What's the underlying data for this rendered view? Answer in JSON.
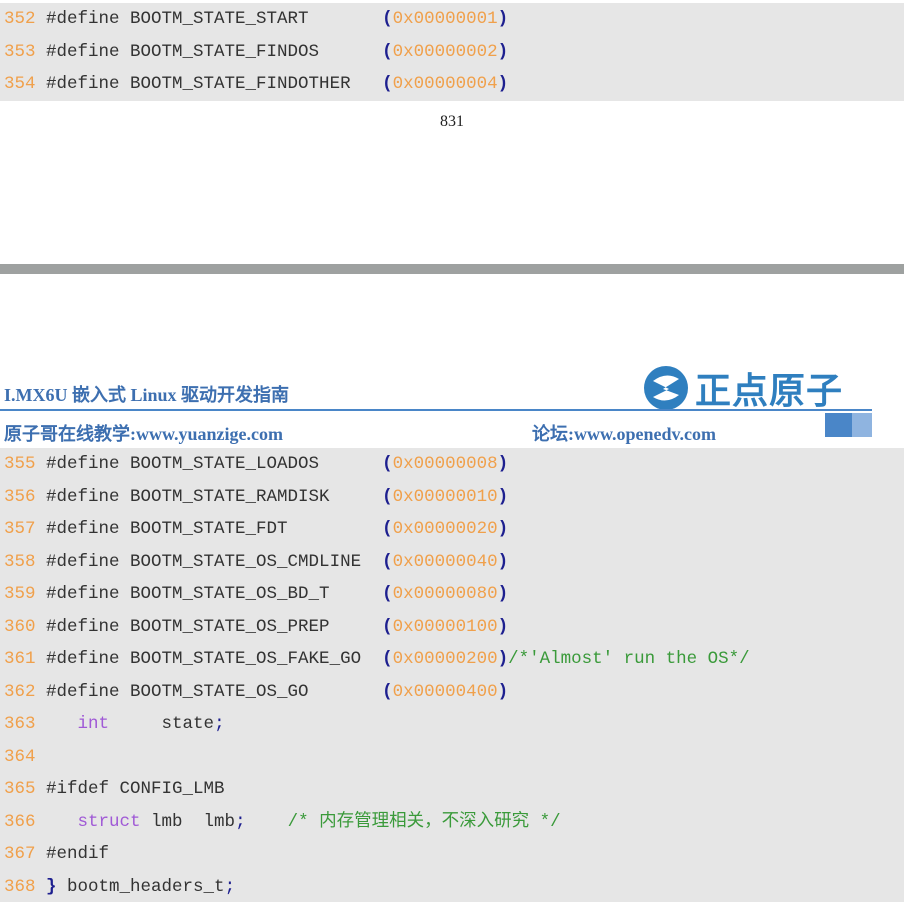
{
  "page_number": "831",
  "header": {
    "title": "I.MX6U 嵌入式 Linux 驱动开发指南",
    "brand": "正点原子",
    "left_link": "原子哥在线教学:www.yuanzige.com",
    "right_link": "论坛:www.openedv.com"
  },
  "colors": {
    "line_number": "#f0a04b",
    "hex_value": "#f0a04b",
    "paren": "#1d1f8f",
    "keyword": "#a05ad6",
    "comment": "#3a9a3a",
    "brand_blue": "#3d6fb0",
    "code_bg": "#e6e6e6"
  },
  "code_top": [
    {
      "ln": "352",
      "text": " #define BOOTM_STATE_START       ",
      "open": "(",
      "hex": "0x00000001",
      "close": ")"
    },
    {
      "ln": "353",
      "text": " #define BOOTM_STATE_FINDOS      ",
      "open": "(",
      "hex": "0x00000002",
      "close": ")"
    },
    {
      "ln": "354",
      "text": " #define BOOTM_STATE_FINDOTHER   ",
      "open": "(",
      "hex": "0x00000004",
      "close": ")"
    }
  ],
  "code_bottom_defines": [
    {
      "ln": "355",
      "text": " #define BOOTM_STATE_LOADOS      ",
      "open": "(",
      "hex": "0x00000008",
      "close": ")",
      "comment": ""
    },
    {
      "ln": "356",
      "text": " #define BOOTM_STATE_RAMDISK     ",
      "open": "(",
      "hex": "0x00000010",
      "close": ")",
      "comment": ""
    },
    {
      "ln": "357",
      "text": " #define BOOTM_STATE_FDT         ",
      "open": "(",
      "hex": "0x00000020",
      "close": ")",
      "comment": ""
    },
    {
      "ln": "358",
      "text": " #define BOOTM_STATE_OS_CMDLINE  ",
      "open": "(",
      "hex": "0x00000040",
      "close": ")",
      "comment": ""
    },
    {
      "ln": "359",
      "text": " #define BOOTM_STATE_OS_BD_T     ",
      "open": "(",
      "hex": "0x00000080",
      "close": ")",
      "comment": ""
    },
    {
      "ln": "360",
      "text": " #define BOOTM_STATE_OS_PREP     ",
      "open": "(",
      "hex": "0x00000100",
      "close": ")",
      "comment": ""
    },
    {
      "ln": "361",
      "text": " #define BOOTM_STATE_OS_FAKE_GO  ",
      "open": "(",
      "hex": "0x00000200",
      "close": ")",
      "comment": "/*'Almost' run the OS*/"
    },
    {
      "ln": "362",
      "text": " #define BOOTM_STATE_OS_GO       ",
      "open": "(",
      "hex": "0x00000400",
      "close": ")",
      "comment": ""
    }
  ],
  "code_bottom_rest": {
    "l363": {
      "ln": "363",
      "indent": "    ",
      "kw": "int",
      "text": "     state",
      "semi": ";"
    },
    "l364": {
      "ln": "364"
    },
    "l365": {
      "ln": "365",
      "text": " #ifdef CONFIG_LMB"
    },
    "l366": {
      "ln": "366",
      "indent": "    ",
      "kw": "struct",
      "text": " lmb  lmb",
      "semi": ";",
      "comment": "    /* 内存管理相关，不深入研究 */"
    },
    "l367": {
      "ln": "367",
      "text": " #endif"
    },
    "l368": {
      "ln": "368",
      "brace": " }",
      "text": " bootm_headers_t",
      "semi": ";"
    }
  }
}
